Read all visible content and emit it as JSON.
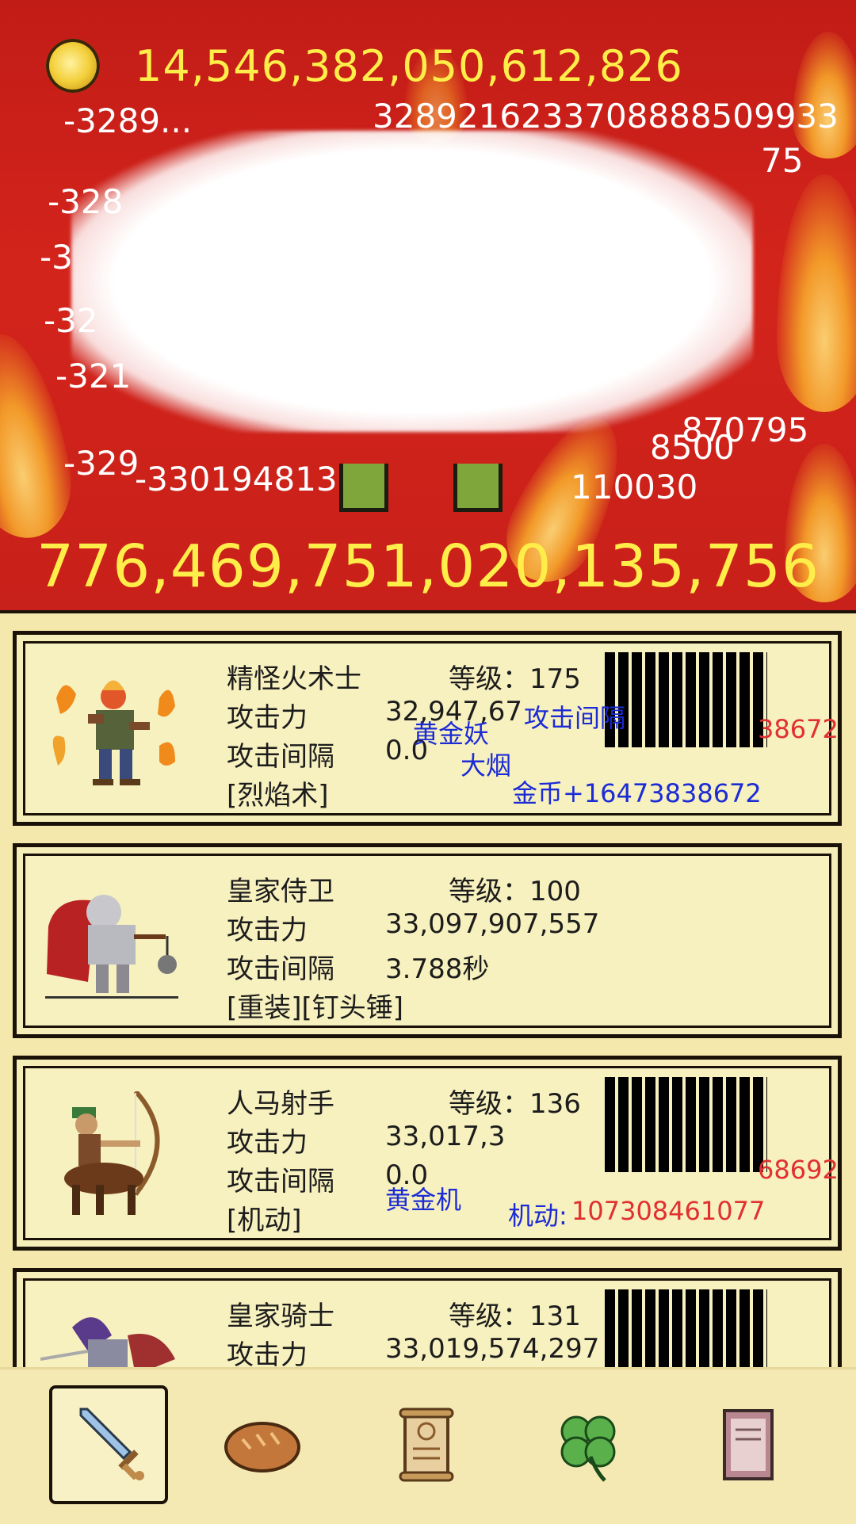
{
  "hud": {
    "coins": "14,546,382,050,612,826",
    "enemy_hp": "776,469,751,020,135,756"
  },
  "damage_numbers": [
    "-3289...",
    "3289216233708888509933",
    "75",
    "-328",
    "-3",
    "-32",
    "-321",
    "870795",
    "8500",
    "-33019481397",
    "110030",
    "-329"
  ],
  "units": [
    {
      "name": "精怪火术士",
      "level_label": "等级：175",
      "attack_label": "攻击力",
      "attack_value": "32,947,67",
      "interval_label": "攻击间隔",
      "interval_value": "0.0",
      "skills": "[烈焰术]",
      "overlay": [
        "黄金妖",
        "大烟",
        "金币+16473838672",
        "攻击间隔"
      ],
      "overlay_red": "38672",
      "barcode_note": "32947"
    },
    {
      "name": "皇家侍卫",
      "level_label": "等级：100",
      "attack_label": "攻击力",
      "attack_value": "33,097,907,557",
      "interval_label": "攻击间隔",
      "interval_value": "3.788秒",
      "skills": "[重装][钉头锤]"
    },
    {
      "name": "人马射手",
      "level_label": "等级：136",
      "attack_label": "攻击力",
      "attack_value": "33,017,3",
      "interval_label": "攻击间隔",
      "interval_value": "0.0",
      "skills": "[机动]",
      "overlay": [
        "黄金机",
        "机动:",
        "107",
        "68692"
      ],
      "overlay_red": "107308461077",
      "barcode_note": "33017"
    },
    {
      "name": "皇家骑士",
      "level_label": "等级：131",
      "attack_label": "攻击力",
      "attack_value": "33,019,574,297",
      "barcode_note": "33019"
    }
  ],
  "nav": {
    "items": [
      "sword-icon",
      "bread-icon",
      "scroll-icon",
      "clover-icon",
      "book-icon"
    ],
    "active": "sword-icon"
  }
}
